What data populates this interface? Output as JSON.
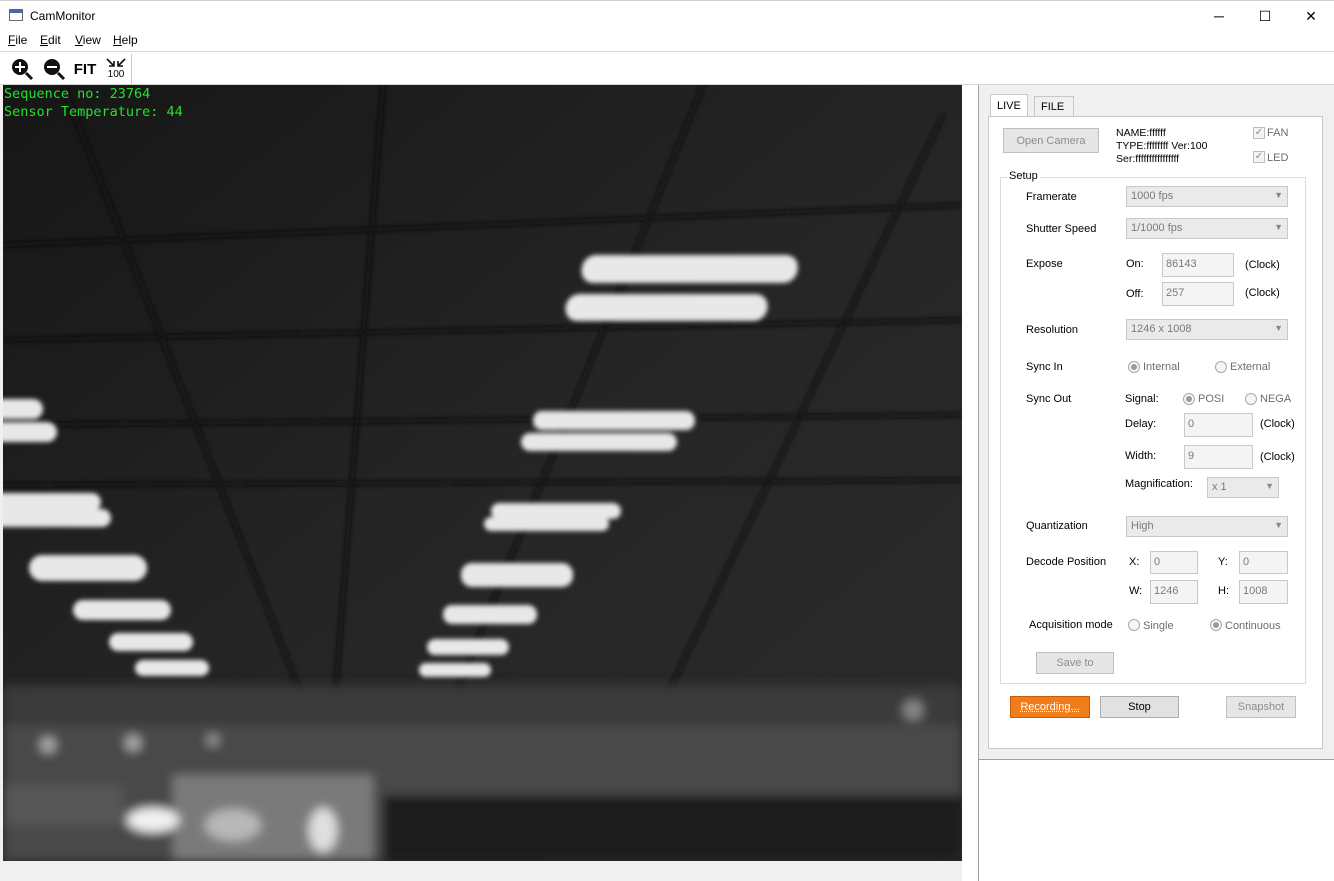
{
  "window": {
    "title": "CamMonitor",
    "minimize": "─",
    "maximize": "☐",
    "close": "✕"
  },
  "menu": [
    "File",
    "Edit",
    "View",
    "Help"
  ],
  "toolbar": {
    "zoom_in": "zoom-in-icon",
    "zoom_out": "zoom-out-icon",
    "fit_label": "FIT",
    "actual_label": "100"
  },
  "overlay": {
    "sequence": "Sequence no: 23764",
    "temperature": "Sensor Temperature: 44"
  },
  "tabs": {
    "live": "LIVE",
    "file": "FILE"
  },
  "camera": {
    "open_button": "Open Camera",
    "name": "NAME:ffffff",
    "type": "TYPE:ffffffff Ver:100",
    "serial": "Ser:ffffffffffffffff",
    "fan_label": "FAN",
    "led_label": "LED",
    "fan_checked": true,
    "led_checked": true
  },
  "setup": {
    "title": "Setup",
    "framerate_label": "Framerate",
    "framerate_value": "1000 fps",
    "shutter_label": "Shutter Speed",
    "shutter_value": "1/1000 fps",
    "expose_label": "Expose",
    "on_label": "On:",
    "on_value": "86143",
    "off_label": "Off:",
    "off_value": "257",
    "clock_unit": "(Clock)",
    "resolution_label": "Resolution",
    "resolution_value": "1246 x 1008",
    "syncin_label": "Sync In",
    "syncin_internal": "Internal",
    "syncin_external": "External",
    "syncout_label": "Sync Out",
    "signal_label": "Signal:",
    "signal_posi": "POSI",
    "signal_nega": "NEGA",
    "delay_label": "Delay:",
    "delay_value": "0",
    "width_label": "Width:",
    "width_value": "9",
    "magnification_label": "Magnification:",
    "magnification_value": "x 1",
    "quantization_label": "Quantization",
    "quantization_value": "High",
    "decode_label": "Decode Position",
    "x_label": "X:",
    "x_value": "0",
    "y_label": "Y:",
    "y_value": "0",
    "w_label": "W:",
    "w_value": "1246",
    "h_label": "H:",
    "h_value": "1008",
    "acq_label": "Acquisition mode",
    "acq_single": "Single",
    "acq_continuous": "Continuous",
    "save_button": "Save to"
  },
  "actions": {
    "recording": "Recording...",
    "stop": "Stop",
    "snapshot": "Snapshot"
  },
  "colors": {
    "osd_text": "#22e22a",
    "recording_button": "#f07d1a"
  }
}
